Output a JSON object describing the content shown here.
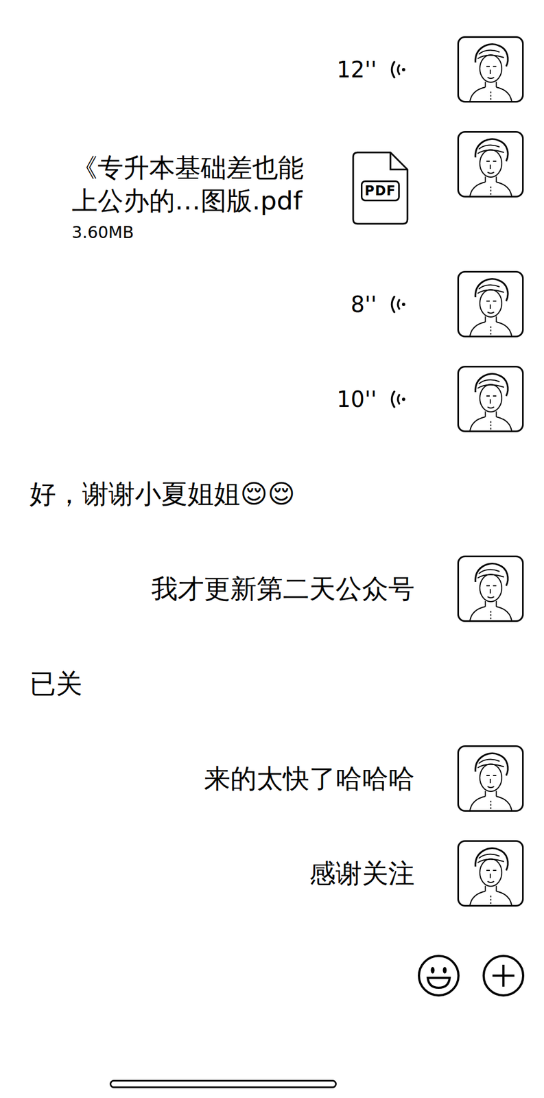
{
  "messages": [
    {
      "kind": "voice",
      "side": "right",
      "duration": "12''"
    },
    {
      "kind": "file",
      "side": "right",
      "name": "《专升本基础差也能上公办的…图版.pdf",
      "size": "3.60MB",
      "file_type": "PDF"
    },
    {
      "kind": "voice",
      "side": "right",
      "duration": "8''"
    },
    {
      "kind": "voice",
      "side": "right",
      "duration": "10''"
    },
    {
      "kind": "text",
      "side": "left",
      "text": "好，谢谢小夏姐姐😌😌"
    },
    {
      "kind": "text",
      "side": "right",
      "text": "我才更新第二天公众号"
    },
    {
      "kind": "text",
      "side": "left",
      "text": "已关"
    },
    {
      "kind": "text",
      "side": "right",
      "text": "来的太快了哈哈哈"
    },
    {
      "kind": "text",
      "side": "right",
      "text": "感谢关注"
    }
  ]
}
